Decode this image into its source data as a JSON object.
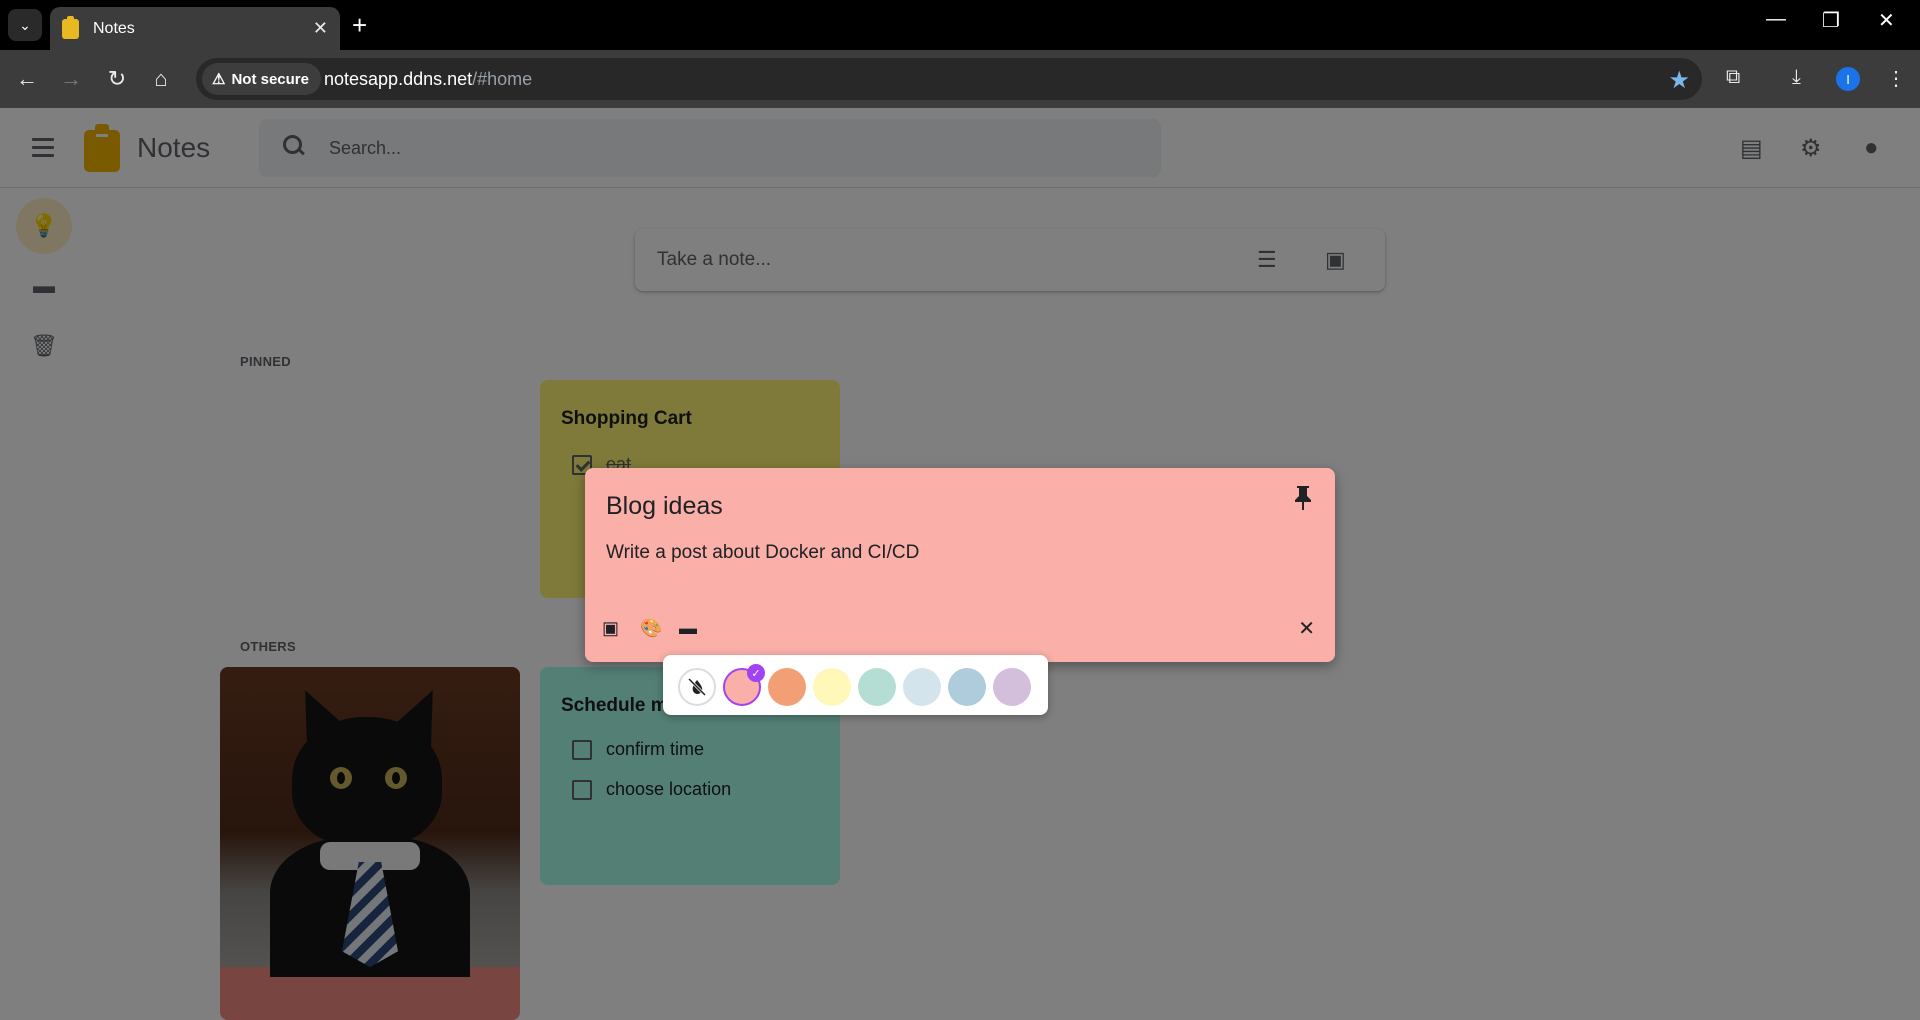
{
  "browser": {
    "tab_title": "Notes",
    "close_tab": "✕",
    "new_tab": "+",
    "security_label": "Not secure",
    "url_host": "notesapp.ddns.net",
    "url_path": "/#home",
    "profile_initial": "I"
  },
  "header": {
    "app_title": "Notes",
    "search_placeholder": "Search..."
  },
  "composer": {
    "placeholder": "Take a note..."
  },
  "sections": {
    "pinned": "PINNED",
    "others": "OTHERS"
  },
  "notes": {
    "shopping": {
      "title": "Shopping Cart",
      "items": [
        {
          "label": "eat",
          "checked": true
        }
      ],
      "color": "#fff475"
    },
    "schedule": {
      "title": "Schedule m",
      "items": [
        {
          "label": "confirm time",
          "checked": false
        },
        {
          "label": "choose location",
          "checked": false
        }
      ],
      "color": "#a7ffeb"
    },
    "cat": {
      "footer_color": "#f28b82"
    }
  },
  "editor": {
    "title": "Blog ideas",
    "body": "Write a post about Docker and CI/CD",
    "close": "✕",
    "background": "#faafa8"
  },
  "palette": {
    "swatches": [
      {
        "name": "none",
        "color": "#ffffff"
      },
      {
        "name": "pink",
        "color": "#faafa8",
        "selected": true
      },
      {
        "name": "peach",
        "color": "#f39f76"
      },
      {
        "name": "yellow",
        "color": "#fff8b8"
      },
      {
        "name": "mint",
        "color": "#b4ddd3"
      },
      {
        "name": "fog",
        "color": "#d4e4ed"
      },
      {
        "name": "storm",
        "color": "#aeccdc"
      },
      {
        "name": "dusk",
        "color": "#d3bfdb"
      }
    ],
    "check": "✓"
  }
}
